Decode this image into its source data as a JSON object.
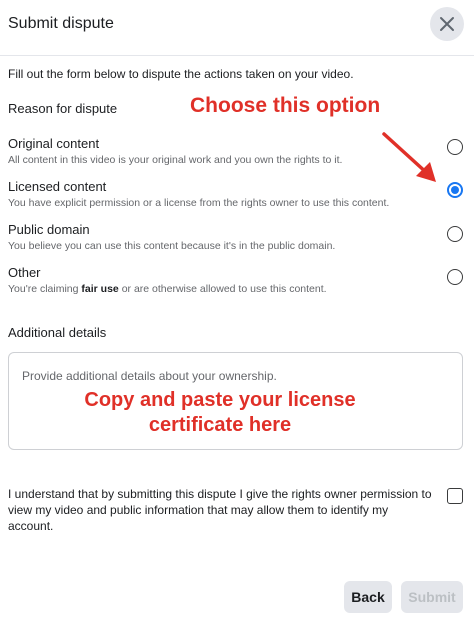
{
  "dialog": {
    "title": "Submit dispute"
  },
  "intro": "Fill out the form below to dispute the actions taken on your video.",
  "reason": {
    "label": "Reason for dispute",
    "options": [
      {
        "title": "Original content",
        "desc": "All content in this video is your original work and you own the rights to it.",
        "selected": false
      },
      {
        "title": "Licensed content",
        "desc": "You have explicit permission or a license from the rights owner to use this content.",
        "selected": true
      },
      {
        "title": "Public domain",
        "desc": "You believe you can use this content because it's in the public domain.",
        "selected": false
      },
      {
        "title": "Other",
        "desc_pre": "You're claiming ",
        "desc_bold": "fair use",
        "desc_post": " or are otherwise allowed to use this content.",
        "selected": false
      }
    ]
  },
  "details": {
    "label": "Additional details",
    "placeholder": "Provide additional details about your ownership."
  },
  "annotations": {
    "choose": "Choose this option",
    "copy": "Copy and paste your license certificate here",
    "color": "#e03028"
  },
  "consent": {
    "text": "I understand that by submitting this dispute I give the rights owner permission to view my video and public information that may allow them to identify my account.",
    "checked": false
  },
  "buttons": {
    "back": "Back",
    "submit": "Submit"
  },
  "colors": {
    "accent": "#1877f2",
    "button_bg": "#e4e6eb"
  }
}
